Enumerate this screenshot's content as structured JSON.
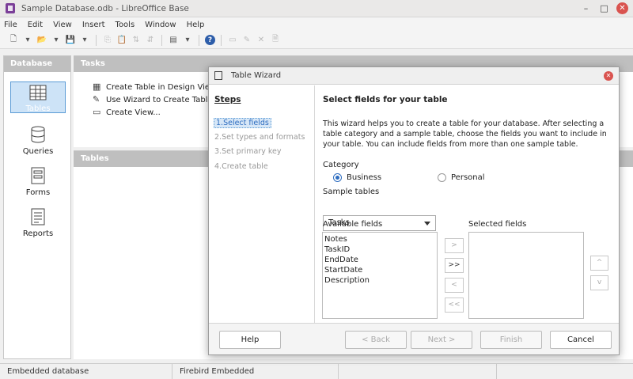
{
  "window": {
    "title": "Sample Database.odb - LibreOffice Base"
  },
  "menubar": [
    "File",
    "Edit",
    "View",
    "Insert",
    "Tools",
    "Window",
    "Help"
  ],
  "left_pane": {
    "header": "Database",
    "items": [
      {
        "label": "Tables",
        "icon": "table-icon",
        "selected": true
      },
      {
        "label": "Queries",
        "icon": "queries-icon"
      },
      {
        "label": "Forms",
        "icon": "forms-icon"
      },
      {
        "label": "Reports",
        "icon": "reports-icon"
      }
    ]
  },
  "tasks_pane": {
    "header": "Tasks",
    "items": [
      {
        "label": "Create Table in Design View...",
        "icon": "table-design-icon"
      },
      {
        "label": "Use Wizard to Create Table...",
        "icon": "wizard-icon"
      },
      {
        "label": "Create View...",
        "icon": "view-icon"
      }
    ]
  },
  "tables_pane": {
    "header": "Tables"
  },
  "statusbar": {
    "left": "Embedded database",
    "middle": "Firebird Embedded"
  },
  "dialog": {
    "title": "Table Wizard",
    "steps_heading": "Steps",
    "steps": [
      "1.Select fields",
      "2.Set types and formats",
      "3.Set primary key",
      "4.Create table"
    ],
    "active_step": 0,
    "heading": "Select fields for your table",
    "description": "This wizard helps you to create a table for your database. After selecting a table category and a sample table, choose the fields you want to include in your table. You can include fields from more than one sample table.",
    "category_label": "Category",
    "category_options": [
      {
        "label": "Business",
        "checked": true
      },
      {
        "label": "Personal",
        "checked": false
      }
    ],
    "sample_tables_label": "Sample tables",
    "sample_table_value": "Tasks",
    "available_label": "Available fields",
    "available_fields": [
      "Notes",
      "TaskID",
      "EndDate",
      "StartDate",
      "Description"
    ],
    "selected_label": "Selected fields",
    "selected_fields": [],
    "move_buttons": {
      "add": ">",
      "add_all": ">>",
      "remove": "<",
      "remove_all": "<<"
    },
    "order_buttons": {
      "up": "^",
      "down": "v"
    },
    "buttons": {
      "help": "Help",
      "back": "< Back",
      "next": "Next >",
      "finish": "Finish",
      "cancel": "Cancel"
    }
  }
}
